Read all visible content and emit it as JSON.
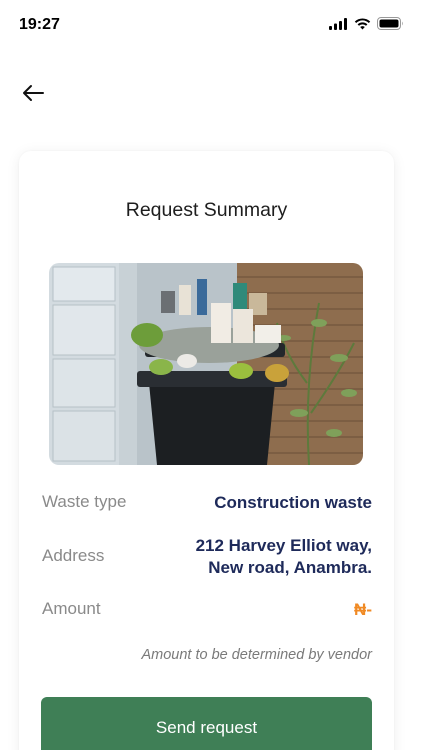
{
  "status_bar": {
    "time": "19:27",
    "icons": [
      "signal-icon",
      "wifi-icon",
      "battery-icon"
    ]
  },
  "nav": {
    "back_icon": "arrow-left-icon"
  },
  "summary": {
    "title": "Request Summary",
    "image_description": "waste-bin-photo",
    "rows": {
      "waste_type": {
        "label": "Waste type",
        "value": "Construction waste"
      },
      "address": {
        "label": "Address",
        "value_line1": "212 Harvey Elliot way,",
        "value_line2": "New road, Anambra."
      },
      "amount": {
        "label": "Amount",
        "value": "₦-"
      }
    },
    "note": "Amount to be determined by vendor",
    "send_button_label": "Send request"
  },
  "colors": {
    "primary_green": "#3f7f56",
    "value_navy": "#1e2a5a",
    "amount_orange": "#f08a24"
  }
}
